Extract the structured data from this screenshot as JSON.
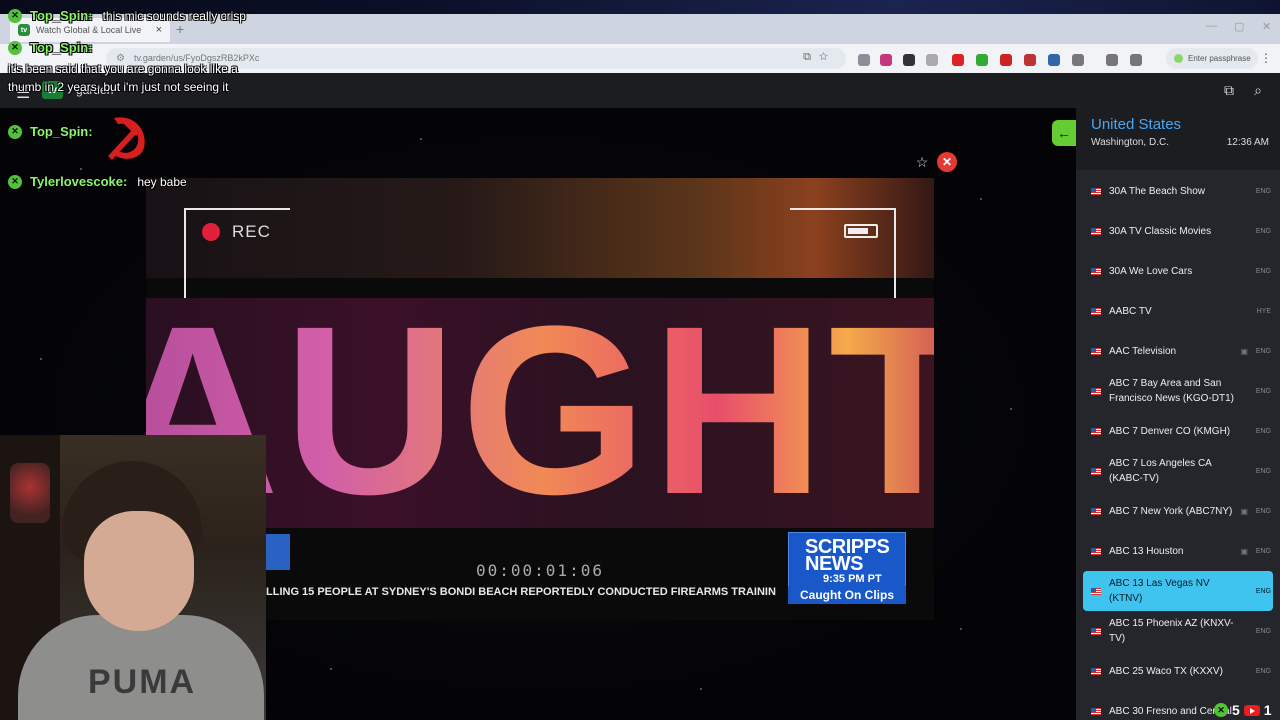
{
  "browser": {
    "tab_title": "Watch Global & Local Live",
    "tab_favicon": "tv",
    "url": "tv.garden/us/FyoDgszRB2kPXc",
    "passphrase_label": "Enter passphrase",
    "new_tab_icon": "+",
    "close_tab_icon": "×"
  },
  "site": {
    "logo": "tv",
    "logo_suffix": "garden"
  },
  "player": {
    "rec_label": "REC",
    "headline": "AUGHT",
    "timecode": "00:00:01:06",
    "ticker": "LLING 15 PEOPLE AT SYDNEY'S BONDI BEACH REPORTEDLY CONDUCTED FIREARMS TRAININ",
    "network_line1": "SCRIPPS",
    "network_line2": "NEWS",
    "network_time": "9:35 PM PT",
    "program": "Caught On Clips"
  },
  "sidebar": {
    "country": "United States",
    "city": "Washington, D.C.",
    "time": "12:36 AM",
    "channels": [
      {
        "name": "30A The Beach Show",
        "lang": "ENG",
        "tv": false,
        "active": false
      },
      {
        "name": "30A TV Classic Movies",
        "lang": "ENG",
        "tv": false,
        "active": false
      },
      {
        "name": "30A We Love Cars",
        "lang": "ENG",
        "tv": false,
        "active": false
      },
      {
        "name": "AABC TV",
        "lang": "HYE",
        "tv": false,
        "active": false
      },
      {
        "name": "AAC Television",
        "lang": "ENG",
        "tv": true,
        "active": false
      },
      {
        "name": "ABC 7 Bay Area and San Francisco News (KGO-DT1)",
        "lang": "ENG",
        "tv": false,
        "active": false
      },
      {
        "name": "ABC 7 Denver CO (KMGH)",
        "lang": "ENG",
        "tv": false,
        "active": false
      },
      {
        "name": "ABC 7 Los Angeles CA (KABC-TV)",
        "lang": "ENG",
        "tv": false,
        "active": false
      },
      {
        "name": "ABC 7 New York (ABC7NY)",
        "lang": "ENG",
        "tv": true,
        "active": false
      },
      {
        "name": "ABC 13 Houston",
        "lang": "ENG",
        "tv": true,
        "active": false
      },
      {
        "name": "ABC 13 Las Vegas NV (KTNV)",
        "lang": "ENG",
        "tv": false,
        "active": true
      },
      {
        "name": "ABC 15 Phoenix AZ (KNXV-TV)",
        "lang": "ENG",
        "tv": false,
        "active": false
      },
      {
        "name": "ABC 25 Waco TX (KXXV)",
        "lang": "ENG",
        "tv": false,
        "active": false
      },
      {
        "name": "ABC 30 Fresno and Central",
        "lang": "",
        "tv": false,
        "active": false
      }
    ]
  },
  "chat": {
    "messages": [
      {
        "user": "Top_Spin:",
        "text": "this mic sounds really crisp"
      },
      {
        "user": "Top_Spin:",
        "text": "it's been said that you are gonna look like a thumb in 2 years, but i'm just not seeing it"
      },
      {
        "user": "Top_Spin:",
        "text": ""
      },
      {
        "user": "Tylerlovescoke:",
        "text": "hey babe"
      }
    ]
  },
  "webcam": {
    "shirt_text": "PUMA"
  },
  "stream_stats": {
    "count_a": "5",
    "count_b": "1"
  }
}
